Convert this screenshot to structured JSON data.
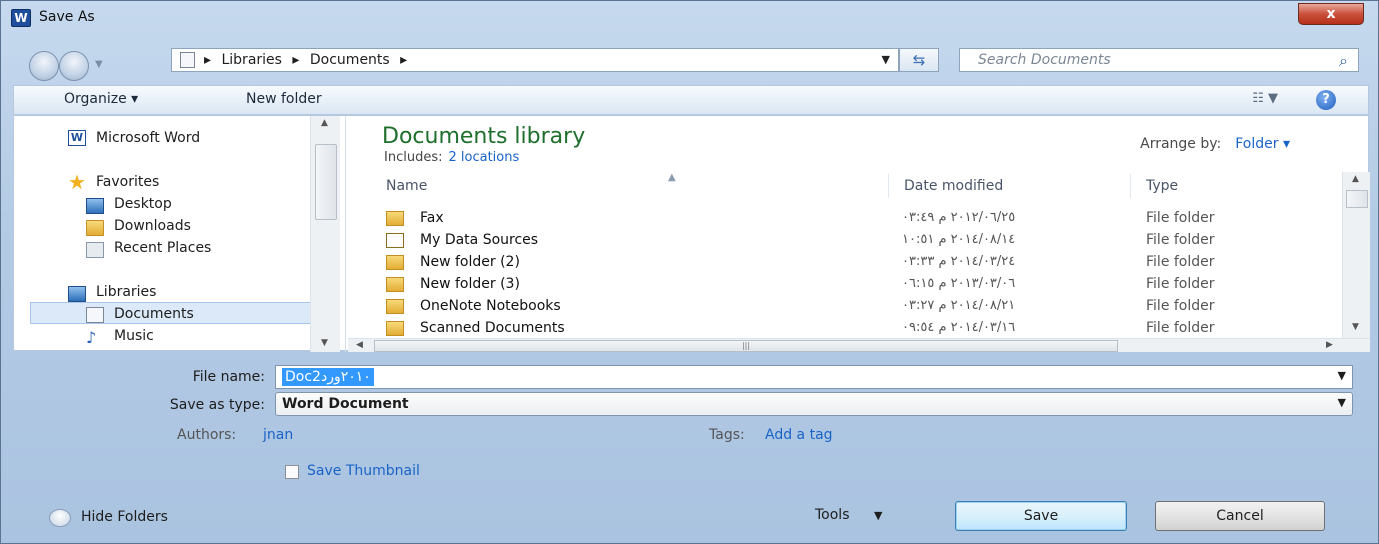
{
  "window": {
    "title": "Save As",
    "close_label": "x"
  },
  "address": {
    "crumbs": [
      "▸",
      "Libraries",
      "▸",
      "Documents",
      "▸"
    ],
    "search_placeholder": "Search Documents"
  },
  "toolbar": {
    "organize": "Organize ▾",
    "new_folder": "New folder"
  },
  "nav": {
    "items": [
      {
        "label": "Microsoft Word",
        "icon": "word-icon"
      },
      {
        "label": "Favorites",
        "icon": "star-icon"
      },
      {
        "label": "Desktop",
        "icon": "desktop-icon"
      },
      {
        "label": "Downloads",
        "icon": "downloads-icon"
      },
      {
        "label": "Recent Places",
        "icon": "recent-places-icon"
      },
      {
        "label": "Libraries",
        "icon": "libraries-icon"
      },
      {
        "label": "Documents",
        "icon": "documents-icon"
      },
      {
        "label": "Music",
        "icon": "music-icon"
      }
    ]
  },
  "library": {
    "title": "Documents library",
    "includes_label": "Includes:",
    "includes_link": "2 locations",
    "arrange_label": "Arrange by:",
    "arrange_value": "Folder ▾"
  },
  "columns": {
    "name": "Name",
    "date": "Date modified",
    "type": "Type"
  },
  "files": [
    {
      "name": "Fax",
      "date": "٢٠١٢/٠٦/٢٥ م ٠٣:٤٩",
      "type": "File folder"
    },
    {
      "name": "My Data Sources",
      "date": "٢٠١٤/٠٨/١٤ م ١٠:٥١",
      "type": "File folder"
    },
    {
      "name": "New folder (2)",
      "date": "٢٠١٤/٠٣/٢٤ م ٠٣:٣٣",
      "type": "File folder"
    },
    {
      "name": "New folder (3)",
      "date": "٢٠١٣/٠٣/٠٦ م ٠٦:١٥",
      "type": "File folder"
    },
    {
      "name": "OneNote Notebooks",
      "date": "٢٠١٤/٠٨/٢١ م ٠٣:٢٧",
      "type": "File folder"
    },
    {
      "name": "Scanned Documents",
      "date": "٢٠١٤/٠٣/١٦ م ٠٩:٥٤",
      "type": "File folder"
    }
  ],
  "form": {
    "file_name_label": "File name:",
    "file_name_value": "Doc٢٠١٠ورد2",
    "save_type_label": "Save as type:",
    "save_type_value": "Word Document",
    "authors_label": "Authors:",
    "authors_value": "jnan",
    "tags_label": "Tags:",
    "tags_value": "Add a tag",
    "thumbnail_label": "Save Thumbnail"
  },
  "footer": {
    "hide_folders": "Hide Folders",
    "tools": "Tools",
    "save": "Save",
    "cancel": "Cancel"
  }
}
